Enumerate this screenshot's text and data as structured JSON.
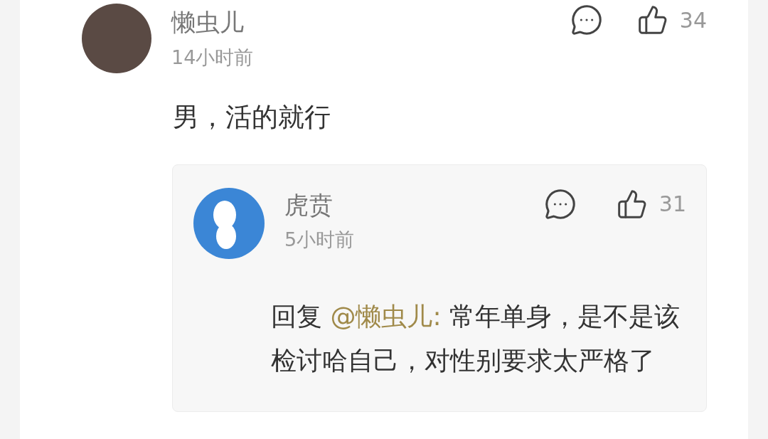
{
  "comment": {
    "author": "懒虫儿",
    "time": "14小时前",
    "likes": "34",
    "text": "男，活的就行",
    "reply": {
      "author": "虎贲",
      "time": "5小时前",
      "likes": "31",
      "prefix": "回复",
      "mention": "@懒虫儿:",
      "text": "常年单身，是不是该检讨哈自己，对性别要求太严格了"
    }
  }
}
